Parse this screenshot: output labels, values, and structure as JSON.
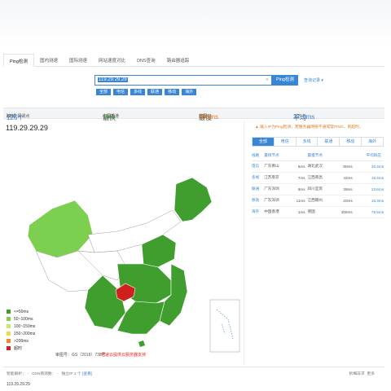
{
  "tabs": [
    {
      "label": "Ping检测",
      "active": true
    },
    {
      "label": "国内测速",
      "active": false
    },
    {
      "label": "国际测速",
      "active": false
    },
    {
      "label": "网站速度对比",
      "active": false
    },
    {
      "label": "DNS查询",
      "active": false
    },
    {
      "label": "路由器追踪",
      "active": false
    }
  ],
  "search": {
    "value": "119.29.29.29",
    "clear_icon": "×",
    "button": "Ping检测",
    "history": "查询记录"
  },
  "isp_buttons": [
    "全部",
    "电信",
    "多线",
    "联通",
    "移动",
    "海外"
  ],
  "stats": {
    "count_prefix": "126个探测点",
    "count_done_label": "(完成",
    "count_done": "126个",
    "count_close": ")",
    "fastest_label": "最快",
    "fastest_loc": "中国香港",
    "fastest_val": "1ms",
    "slowest_label": "最慢",
    "slowest_loc": "德国",
    "slowest_val": "306ms",
    "avg_label": "平均",
    "avg_val": "37.8ms"
  },
  "map": {
    "ip": "119.29.29.29",
    "legend": [
      {
        "label": "<=50ms",
        "color": "#3f9e2e"
      },
      {
        "label": "50~100ms",
        "color": "#7ccf4f"
      },
      {
        "label": "100~150ms",
        "color": "#c8e86e"
      },
      {
        "label": "150~200ms",
        "color": "#f2d64b"
      },
      {
        "label": ">200ms",
        "color": "#f08c22"
      },
      {
        "label": "超时",
        "color": "#cf1f1f"
      }
    ],
    "note": "审图号：GS（2018）738号",
    "link": "亿速云提供云服务器支持"
  },
  "side": {
    "notice": "输入IP为Ping检测，若服务器网络不通或禁PING，则超时。",
    "tabs": [
      "全部",
      "电信",
      "多线",
      "联通",
      "移动",
      "海外"
    ],
    "headers": [
      "线路",
      "最快节点",
      "",
      "最慢节点",
      "",
      "平均响应"
    ],
    "rows": [
      {
        "isp": "电信",
        "fast_loc": "广东佛山",
        "fast": "6ms",
        "slow_loc": "湖北武汉",
        "slow": "80ms",
        "avg": "20.4ms"
      },
      {
        "isp": "多线",
        "fast_loc": "江苏南京",
        "fast": "7ms",
        "slow_loc": "江西南昌",
        "slow": "42ms",
        "avg": "16.4ms"
      },
      {
        "isp": "联通",
        "fast_loc": "广东深圳",
        "fast": "9ms",
        "slow_loc": "四川宜宾",
        "slow": "39ms",
        "avg": "23.6ms"
      },
      {
        "isp": "移动",
        "fast_loc": "广东深圳",
        "fast": "11ms",
        "slow_loc": "江西赣州",
        "slow": "20ms",
        "avg": "16.3ms"
      },
      {
        "isp": "海外",
        "fast_loc": "中国香港",
        "fast": "1ms",
        "slow_loc": "德国",
        "slow": "306ms",
        "avg": "78.5ms"
      }
    ]
  },
  "footer": {
    "smart_label": "智能解析：",
    "cdn_label": "CDN猜测数：",
    "ip_label": "独立IP 1 个",
    "detail": "[查看]",
    "right1": "拆细非求",
    "right2": "更多",
    "ip": "119.29.29.29"
  }
}
